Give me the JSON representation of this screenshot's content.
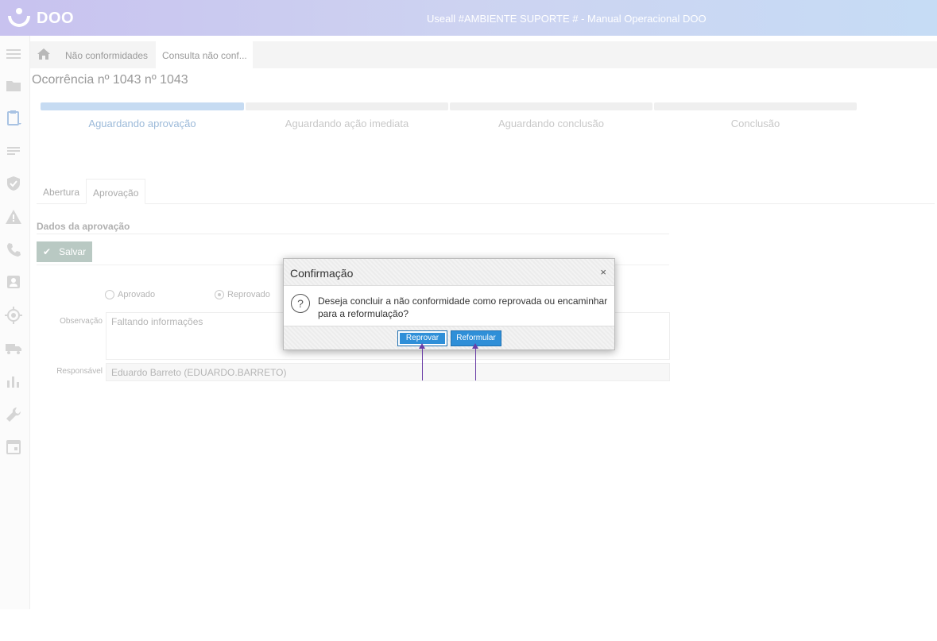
{
  "app": {
    "logo_text": "DOO",
    "window_title": "Useall #AMBIENTE SUPORTE # - Manual Operacional DOO"
  },
  "sidebar": {
    "icons": [
      "menu-icon",
      "folder-icon",
      "clipboard-icon",
      "list-icon",
      "shield-check-icon",
      "warning-icon",
      "phone-icon",
      "contact-card-icon",
      "target-icon",
      "truck-icon",
      "bar-chart-icon",
      "wrench-icon",
      "calendar-icon"
    ]
  },
  "breadcrumb": {
    "items": [
      "Não conformidades",
      "Consulta não conf..."
    ]
  },
  "page": {
    "title": "Ocorrência nº 1043 nº 1043"
  },
  "steps": [
    {
      "label": "Aguardando aprovação",
      "active": true
    },
    {
      "label": "Aguardando ação imediata",
      "active": false
    },
    {
      "label": "Aguardando conclusão",
      "active": false
    },
    {
      "label": "Conclusão",
      "active": false
    }
  ],
  "tabs": [
    {
      "label": "Abertura",
      "active": false
    },
    {
      "label": "Aprovação",
      "active": true
    }
  ],
  "form": {
    "section_title": "Dados da aprovação",
    "save_label": "Salvar",
    "radio_aprovado": "Aprovado",
    "radio_reprovado": "Reprovado",
    "selected": "Reprovado",
    "observacao_label": "Observação",
    "observacao_value": "Faltando informações",
    "responsavel_label": "Responsável",
    "responsavel_value": "Eduardo Barreto (EDUARDO.BARRETO)"
  },
  "dialog": {
    "title": "Confirmação",
    "close": "×",
    "message": "Deseja concluir a não conformidade como reprovada ou encaminhar para a reformulação?",
    "btn_reprovar": "Reprovar",
    "btn_reformular": "Reformular"
  },
  "colors": {
    "accent_button": "#2f8fd8",
    "annotation_arrow": "#6a3da6",
    "active_step": "#c6dbf2"
  }
}
